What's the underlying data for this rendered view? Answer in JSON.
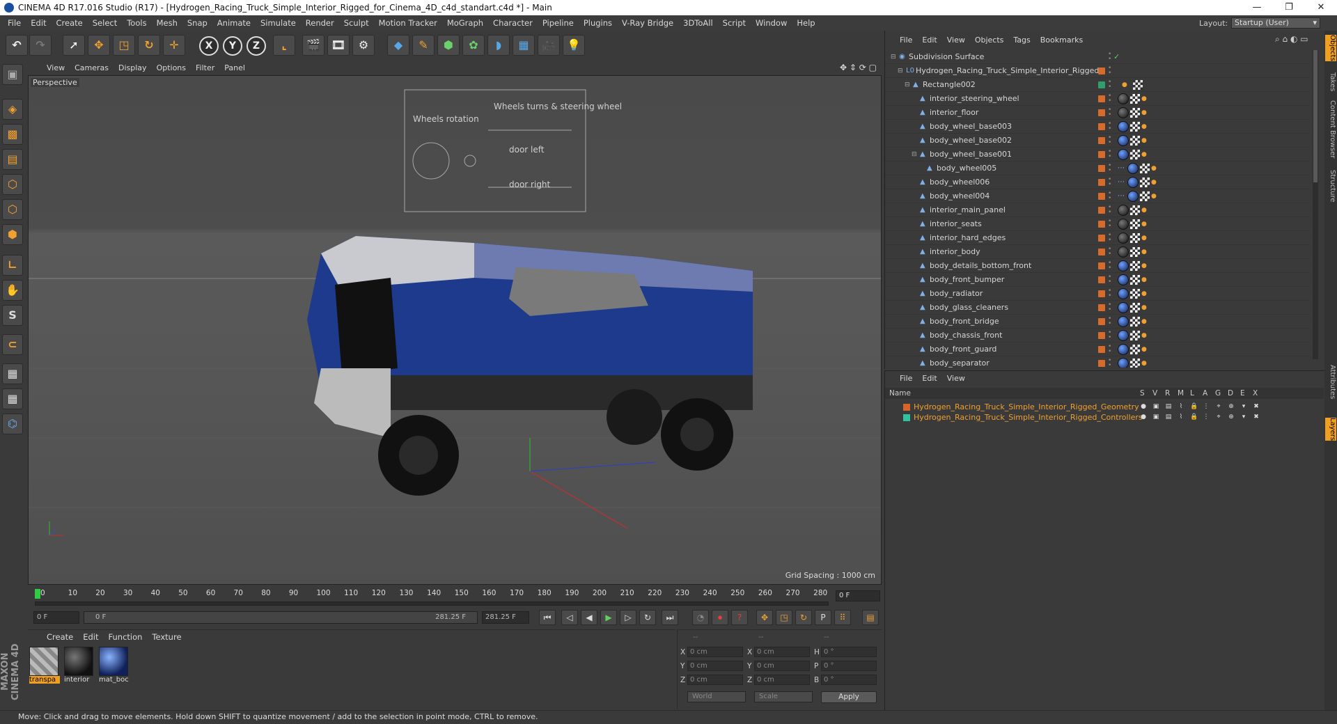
{
  "window": {
    "title": "CINEMA 4D R17.016 Studio (R17) - [Hydrogen_Racing_Truck_Simple_Interior_Rigged_for_Cinema_4D_c4d_standart.c4d *] - Main",
    "minimize": "—",
    "maximize": "❐",
    "close": "✕"
  },
  "menubar": {
    "items": [
      "File",
      "Edit",
      "Create",
      "Select",
      "Tools",
      "Mesh",
      "Snap",
      "Animate",
      "Simulate",
      "Render",
      "Sculpt",
      "Motion Tracker",
      "MoGraph",
      "Character",
      "Pipeline",
      "Plugins",
      "V-Ray Bridge",
      "3DToAll",
      "Script",
      "Window",
      "Help"
    ],
    "layout_label": "Layout:",
    "layout_value": "Startup (User)"
  },
  "toolbar": {
    "axis_x": "X",
    "axis_y": "Y",
    "axis_z": "Z"
  },
  "viewport": {
    "menu": [
      "View",
      "Cameras",
      "Display",
      "Options",
      "Filter",
      "Panel"
    ],
    "label": "Perspective",
    "grid_spacing": "Grid Spacing : 1000 cm",
    "controller_texts": [
      "Wheels rotation",
      "Wheels turns & steering wheel",
      "door left",
      "door right"
    ]
  },
  "timeline": {
    "ticks": [
      "0",
      "10",
      "20",
      "30",
      "40",
      "50",
      "60",
      "70",
      "80",
      "90",
      "100",
      "110",
      "120",
      "130",
      "140",
      "150",
      "160",
      "170",
      "180",
      "190",
      "200",
      "210",
      "220",
      "230",
      "240",
      "250",
      "260",
      "270",
      "280"
    ],
    "frame_field": "0 F"
  },
  "transport": {
    "start": "0 F",
    "min": "0 F",
    "max": "281.25 F",
    "end": "281.25 F"
  },
  "materials": {
    "menu": [
      "Create",
      "Edit",
      "Function",
      "Texture"
    ],
    "items": [
      {
        "label": "transpa",
        "kind": "checker",
        "selected": true
      },
      {
        "label": "interior",
        "kind": "dark",
        "selected": false
      },
      {
        "label": "mat_boc",
        "kind": "blue",
        "selected": false
      }
    ]
  },
  "coordinates": {
    "headers": [
      "--",
      "--",
      "--"
    ],
    "rows": [
      {
        "a": "X",
        "av": "0 cm",
        "b": "X",
        "bv": "0 cm",
        "c": "H",
        "cv": "0 °"
      },
      {
        "a": "Y",
        "av": "0 cm",
        "b": "Y",
        "bv": "0 cm",
        "c": "P",
        "cv": "0 °"
      },
      {
        "a": "Z",
        "av": "0 cm",
        "b": "Z",
        "bv": "0 cm",
        "c": "B",
        "cv": "0 °"
      }
    ],
    "mode1": "World",
    "mode2": "Scale",
    "apply": "Apply"
  },
  "status": "Move: Click and drag to move elements. Hold down SHIFT to quantize movement / add to the selection in point mode, CTRL to remove.",
  "objects": {
    "menu": [
      "File",
      "Edit",
      "View",
      "Objects",
      "Tags",
      "Bookmarks"
    ],
    "rows": [
      {
        "name": "Subdivision Surface",
        "indent": 0,
        "tags": "check",
        "color": "none"
      },
      {
        "name": "Hydrogen_Racing_Truck_Simple_Interior_Rigged",
        "indent": 1,
        "tags": "",
        "color": "orange"
      },
      {
        "name": "Rectangle002",
        "indent": 2,
        "tags": "rect",
        "color": "green"
      },
      {
        "name": "interior_steering_wheel",
        "indent": 3,
        "tags": "dark",
        "color": "orange"
      },
      {
        "name": "interior_floor",
        "indent": 3,
        "tags": "dark",
        "color": "orange"
      },
      {
        "name": "body_wheel_base003",
        "indent": 3,
        "tags": "blue",
        "color": "orange"
      },
      {
        "name": "body_wheel_base002",
        "indent": 3,
        "tags": "blue",
        "color": "orange"
      },
      {
        "name": "body_wheel_base001",
        "indent": 3,
        "tags": "blue",
        "color": "orange"
      },
      {
        "name": "body_wheel005",
        "indent": 4,
        "tags": "wheel",
        "color": "orange"
      },
      {
        "name": "body_wheel006",
        "indent": 3,
        "tags": "wheel",
        "color": "orange"
      },
      {
        "name": "body_wheel004",
        "indent": 3,
        "tags": "wheel",
        "color": "orange"
      },
      {
        "name": "interior_main_panel",
        "indent": 3,
        "tags": "dark",
        "color": "orange"
      },
      {
        "name": "interior_seats",
        "indent": 3,
        "tags": "dark",
        "color": "orange"
      },
      {
        "name": "interior_hard_edges",
        "indent": 3,
        "tags": "dark",
        "color": "orange"
      },
      {
        "name": "interior_body",
        "indent": 3,
        "tags": "dark",
        "color": "orange"
      },
      {
        "name": "body_details_bottom_front",
        "indent": 3,
        "tags": "blue",
        "color": "orange"
      },
      {
        "name": "body_front_bumper",
        "indent": 3,
        "tags": "blue",
        "color": "orange"
      },
      {
        "name": "body_radiator",
        "indent": 3,
        "tags": "blue",
        "color": "orange"
      },
      {
        "name": "body_glass_cleaners",
        "indent": 3,
        "tags": "blue",
        "color": "orange"
      },
      {
        "name": "body_front_bridge",
        "indent": 3,
        "tags": "blue",
        "color": "orange"
      },
      {
        "name": "body_chassis_front",
        "indent": 3,
        "tags": "blue",
        "color": "orange"
      },
      {
        "name": "body_front_guard",
        "indent": 3,
        "tags": "blue",
        "color": "orange"
      },
      {
        "name": "body_separator",
        "indent": 3,
        "tags": "blue",
        "color": "orange"
      }
    ]
  },
  "layers": {
    "menu": [
      "File",
      "Edit",
      "View"
    ],
    "header_name": "Name",
    "header_cols": [
      "S",
      "V",
      "R",
      "M",
      "L",
      "A",
      "G",
      "D",
      "E",
      "X"
    ],
    "rows": [
      {
        "name": "Hydrogen_Racing_Truck_Simple_Interior_Rigged_Geometry",
        "color": "#d8642a"
      },
      {
        "name": "Hydrogen_Racing_Truck_Simple_Interior_Rigged_Controllers",
        "color": "#2ec4a0"
      }
    ]
  },
  "right_tabs": [
    "Objects",
    "Takes",
    "Content Browser",
    "Structure",
    "Attributes",
    "Layers"
  ]
}
